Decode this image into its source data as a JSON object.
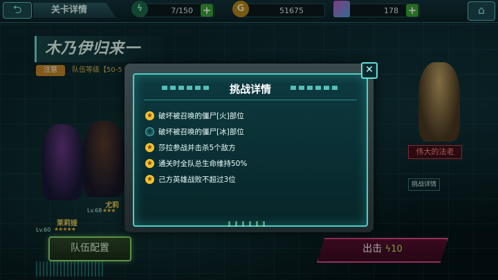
{
  "topbar": {
    "back_icon": "back-arrow-icon",
    "title": "关卡详情",
    "energy": {
      "icon": "lightning-icon",
      "value": "7/150",
      "plus": "+"
    },
    "gold": {
      "icon": "gold-coin-icon",
      "value": "51675",
      "plus": "+"
    },
    "gems": {
      "icon": "gem-cube-icon",
      "value": "178",
      "plus": "+"
    },
    "home_icon": "home-icon"
  },
  "stage": {
    "name": "木乃伊归来一",
    "note_label": "注意",
    "team_level": "队伍等级【50-5"
  },
  "heroes": [
    {
      "name": "茉莉娅",
      "level": "Lv.60",
      "stars": "★★★★★"
    },
    {
      "name": "尤莉",
      "level": "Lv.68",
      "stars": "★★★"
    }
  ],
  "boss": {
    "name": "伟大的法老"
  },
  "side": {
    "challenge_detail": "挑战详情"
  },
  "buttons": {
    "team_setup": "队伍配置",
    "fight": "出击",
    "fight_cost": "10"
  },
  "modal": {
    "title": "挑战详情",
    "close_label": "✕",
    "objectives": [
      {
        "text": "破坏被召唤的僵尸[火]部位",
        "done": true
      },
      {
        "text": "破坏被召唤的僵尸[冰]部位",
        "done": false
      },
      {
        "text": "莎拉参战并击杀5个敌方",
        "done": true
      },
      {
        "text": "通关时全队总生命维持50%",
        "done": true
      },
      {
        "text": "己方英雄战败不超过3位",
        "done": true
      }
    ]
  },
  "colors": {
    "accent": "#49d1c7",
    "star": "#f5c230",
    "fight": "#e04a8a",
    "team": "#8ee26e"
  }
}
